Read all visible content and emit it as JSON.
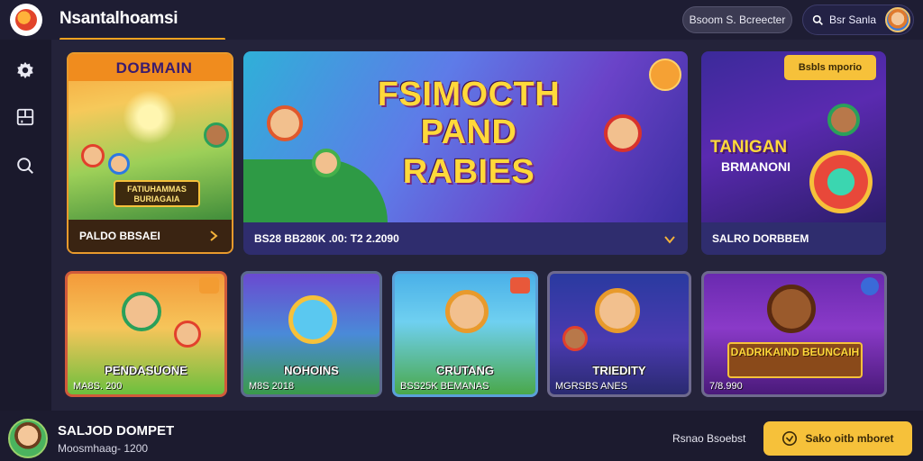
{
  "header": {
    "app_title": "Nsantalhoamsi",
    "search_label": "Bsoom S. Bcreecter",
    "user_label": "Bsr Sanla",
    "icons": {
      "logo": "app-logo-icon",
      "search": "search-icon",
      "avatar": "user-avatar"
    }
  },
  "sidebar": {
    "items": [
      {
        "icon": "gear-icon"
      },
      {
        "icon": "dashboard-icon"
      },
      {
        "icon": "search-icon"
      }
    ]
  },
  "featured": [
    {
      "art_title": "DOBMAIN",
      "banner_text": "FATIUHAMMAS BURIAGAIA",
      "caption": "PALDO BBSAEI"
    },
    {
      "art_title_line1": "FSIMOCTH",
      "art_title_line2": "PAND",
      "art_title_line3": "RABIES",
      "caption": "BS28 BB280K .00:   T2 2.2090"
    },
    {
      "badge_label": "Bsbls mporio",
      "art_title_line1": "TANIGAN",
      "art_title_line2": "BRMANONI",
      "caption": "SALRO DORBBEM"
    }
  ],
  "games": [
    {
      "title": "PENDASUONE",
      "meta": "MA8S. 200"
    },
    {
      "title": "NOHOINS",
      "meta": "M8S 2018"
    },
    {
      "title": "CRUTANG",
      "meta": "BSS25K BEMANAS"
    },
    {
      "title": "TRIEDITY",
      "meta": "MGRSBS ANES"
    },
    {
      "title": "DADRIKAIND BEUNCAIH",
      "meta": "7/8.990"
    }
  ],
  "footer": {
    "wallet_title": "SALJOD DOMPET",
    "wallet_sub": "Moosmhaag- 1200",
    "link_label": "Rsnao  Bsoebst",
    "cta_label": "Sako oitb mboret"
  },
  "colors": {
    "accent": "#f6c13a",
    "underline": "#f0a21f",
    "background": "#1b1a2e",
    "caption_bar": "#2f2d6e"
  }
}
